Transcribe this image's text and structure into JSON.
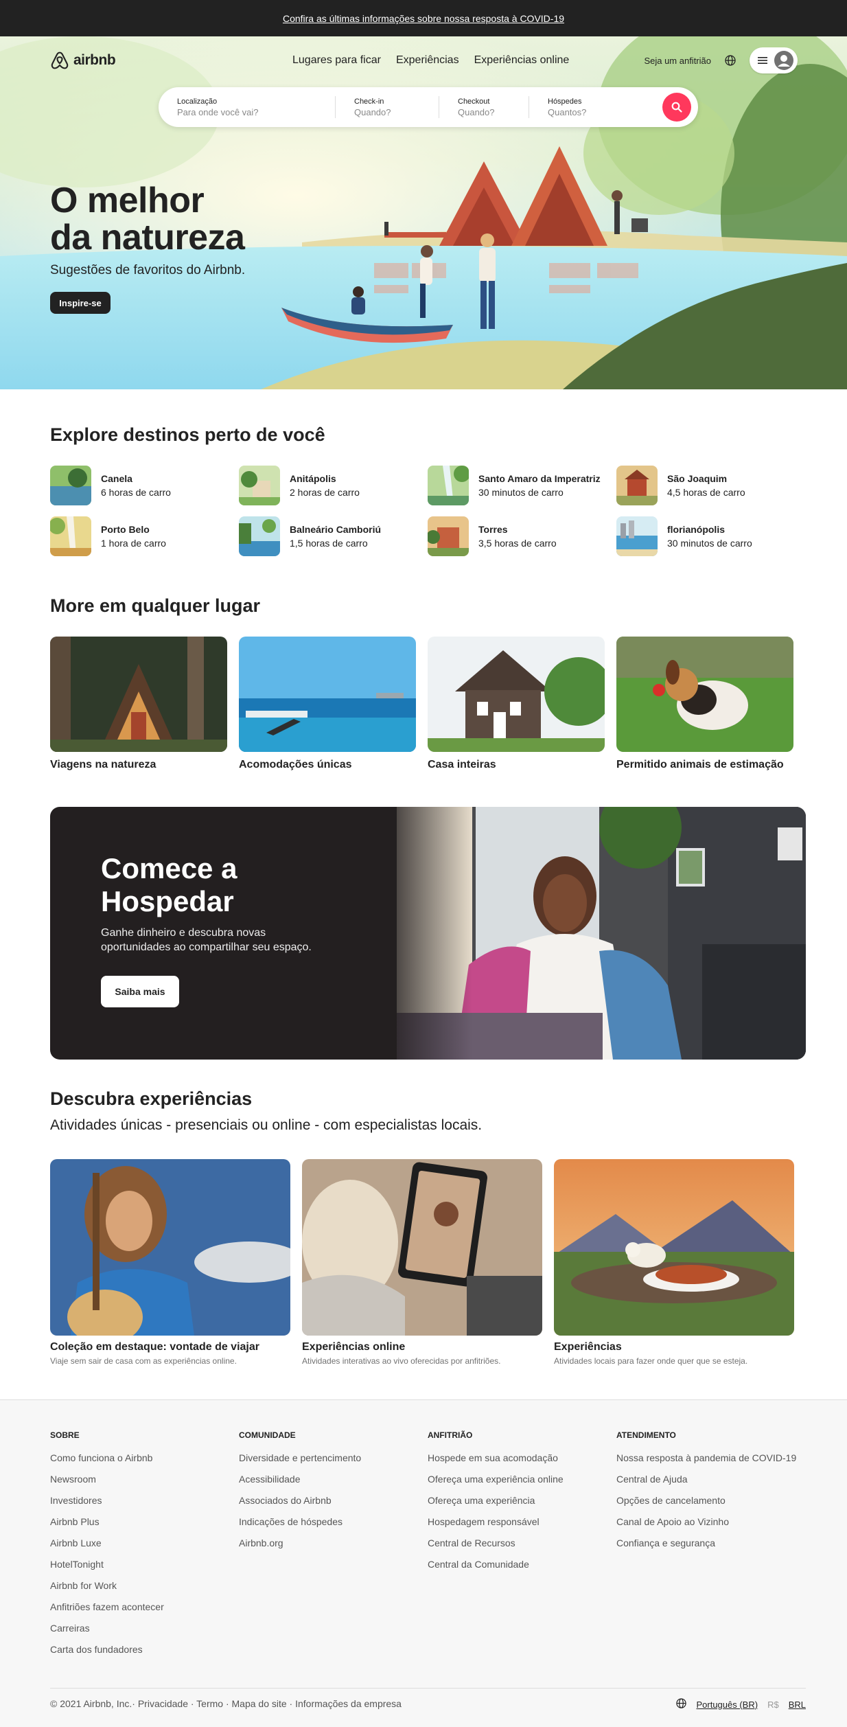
{
  "banner": {
    "text": "Confira as últimas informações sobre nossa resposta à COVID-19"
  },
  "nav": {
    "logo_text": "airbnb",
    "links": [
      "Lugares para ficar",
      "Experiências",
      "Experiências online"
    ],
    "host_link": "Seja um anfitrião"
  },
  "search": {
    "location": {
      "label": "Localização",
      "placeholder": "Para onde você vai?"
    },
    "checkin": {
      "label": "Check-in",
      "placeholder": "Quando?"
    },
    "checkout": {
      "label": "Checkout",
      "placeholder": "Quando?"
    },
    "guests": {
      "label": "Hóspedes",
      "placeholder": "Quantos?"
    }
  },
  "hero": {
    "title_line1": "O melhor",
    "title_line2": "da natureza",
    "subtitle": "Sugestões de favoritos do Airbnb.",
    "button": "Inspire-se"
  },
  "nearby": {
    "title": "Explore destinos perto de você",
    "items": [
      {
        "name": "Canela",
        "time": "6 horas de carro"
      },
      {
        "name": "Anitápolis",
        "time": "2 horas de carro"
      },
      {
        "name": "Santo Amaro da Imperatriz",
        "time": "30 minutos de carro"
      },
      {
        "name": "São Joaquim",
        "time": "4,5 horas de carro"
      },
      {
        "name": "Porto Belo",
        "time": "1 hora de carro"
      },
      {
        "name": "Balneário Camboriú",
        "time": "1,5 horas de carro"
      },
      {
        "name": "Torres",
        "time": "3,5 horas de carro"
      },
      {
        "name": "florianópolis",
        "time": "30 minutos de carro"
      }
    ]
  },
  "live_anywhere": {
    "title": "More em qualquer lugar",
    "items": [
      "Viagens na natureza",
      "Acomodações únicas",
      "Casa inteiras",
      "Permitido animais de estimação"
    ]
  },
  "host_card": {
    "title_line1": "Comece a",
    "title_line2": "Hospedar",
    "subtitle": "Ganhe dinheiro e descubra novas oportunidades ao compartilhar seu espaço.",
    "button": "Saiba mais"
  },
  "experiences": {
    "title": "Descubra experiências",
    "subtitle": "Atividades únicas - presenciais ou online - com especialistas locais.",
    "items": [
      {
        "title": "Coleção em destaque: vontade de viajar",
        "desc": "Viaje sem sair de casa com as experiências online."
      },
      {
        "title": "Experiências online",
        "desc": "Atividades interativas ao vivo oferecidas por anfitriões."
      },
      {
        "title": "Experiências",
        "desc": "Atividades locais para fazer onde quer que se esteja."
      }
    ]
  },
  "footer": {
    "columns": [
      {
        "heading": "SOBRE",
        "links": [
          "Como funciona o Airbnb",
          "Newsroom",
          "Investidores",
          "Airbnb Plus",
          "Airbnb Luxe",
          "HotelTonight",
          "Airbnb for Work",
          "Anfitriões fazem acontecer",
          "Carreiras",
          "Carta dos fundadores"
        ]
      },
      {
        "heading": "COMUNIDADE",
        "links": [
          "Diversidade e pertencimento",
          "Acessibilidade",
          "Associados do Airbnb",
          "Indicações de hóspedes",
          "Airbnb.org"
        ]
      },
      {
        "heading": "ANFITRIÃO",
        "links": [
          "Hospede em sua acomodação",
          "Ofereça uma experiência online",
          "Ofereça uma experiência",
          "Hospedagem responsável",
          "Central de Recursos",
          "Central da Comunidade"
        ]
      },
      {
        "heading": "ATENDIMENTO",
        "links": [
          "Nossa resposta à pandemia de COVID-19",
          "Central de Ajuda",
          "Opções de cancelamento",
          "Canal de Apoio ao Vizinho",
          "Confiança e segurança"
        ]
      }
    ],
    "copyright": "© 2021 Airbnb, Inc.· Privacidade · Termo · Mapa do site · Informações da empresa",
    "language": "Português (BR)",
    "currency_symbol": "R$",
    "currency": "BRL"
  },
  "colors": {
    "brand": "#ff385c",
    "dark": "#222222"
  }
}
